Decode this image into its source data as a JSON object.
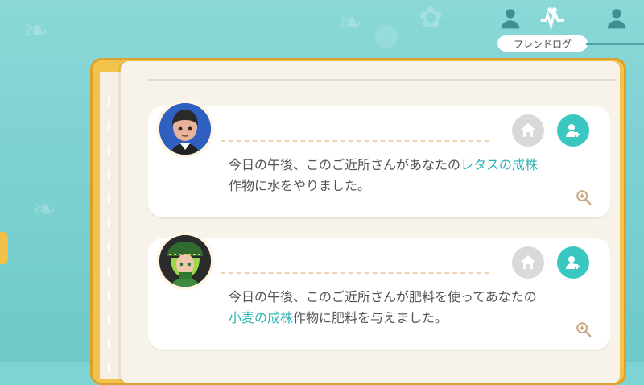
{
  "nav": {
    "label": "フレンドログ",
    "icons": [
      "friends-icon",
      "activity-icon",
      "profile-icon"
    ]
  },
  "entries": [
    {
      "text_before": "今日の午後、このご近所さんがあなたの",
      "highlight": "レタスの成株",
      "text_after": "作物に水をやりました。"
    },
    {
      "text_before": "今日の午後、このご近所さんが肥料を使ってあなたの",
      "highlight": "小麦の成株",
      "text_after": "作物に肥料を与えました。"
    }
  ],
  "colors": {
    "accent": "#39c7c1",
    "highlight": "#2eb4b6",
    "book": "#f3c24a"
  }
}
